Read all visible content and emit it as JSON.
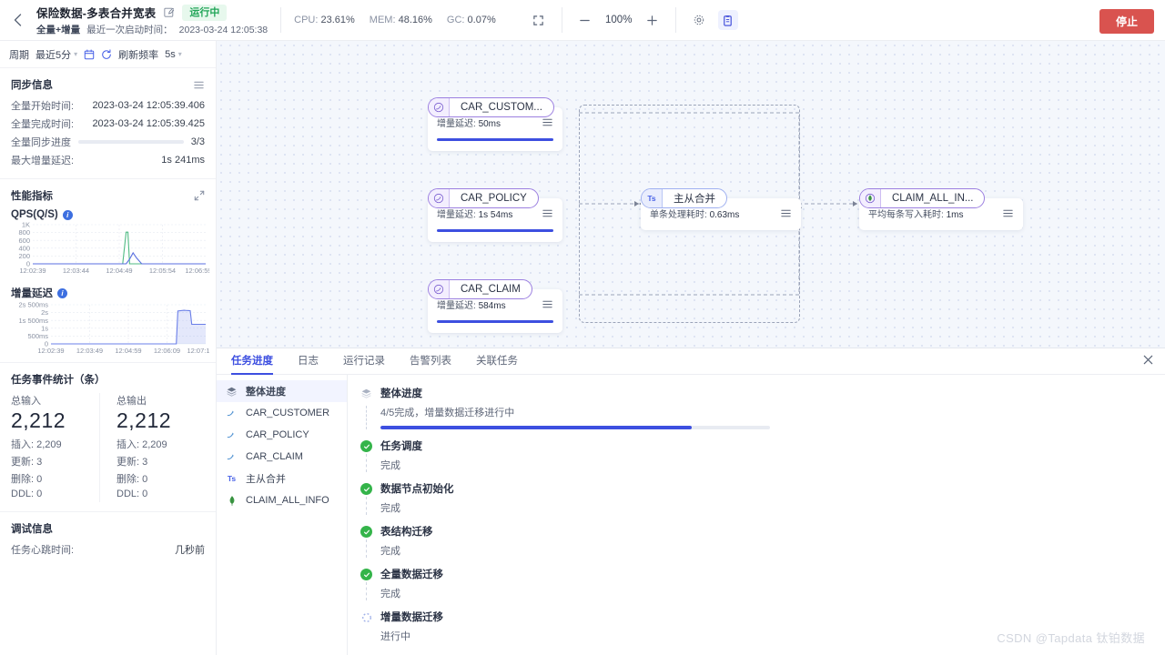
{
  "header": {
    "back_icon": "chevron-left-icon",
    "task_title": "保险数据-多表合并宽表",
    "edit_icon": "edit-icon",
    "status": "运行中",
    "sync_type": "全量+增量",
    "last_start_label": "最近一次启动时间：",
    "last_start_value": "2023-03-24 12:05:38",
    "cpu_label": "CPU:",
    "cpu_value": "23.61%",
    "mem_label": "MEM:",
    "mem_value": "48.16%",
    "gc_label": "GC:",
    "gc_value": "0.07%",
    "fit_icon": "fit-screen-icon",
    "zoom_out_icon": "minus-icon",
    "zoom_level": "100%",
    "zoom_in_icon": "plus-icon",
    "settings_icon": "gear-icon",
    "panel_icon": "clipboard-icon",
    "stop_button": "停止"
  },
  "period_bar": {
    "label": "周期",
    "range": "最近5分",
    "calendar_icon": "calendar-icon",
    "refresh_icon": "refresh-icon",
    "freq_label": "刷新频率",
    "freq_value": "5s"
  },
  "sync_info": {
    "title": "同步信息",
    "menu_icon": "list-icon",
    "rows": [
      {
        "key": "全量开始时间:",
        "value": "2023-03-24 12:05:39.406"
      },
      {
        "key": "全量完成时间:",
        "value": "2023-03-24 12:05:39.425"
      }
    ],
    "progress_label": "全量同步进度",
    "progress_value": "3/3",
    "progress_pct": 100,
    "max_delay_label": "最大增量延迟:",
    "max_delay_value": "1s 241ms"
  },
  "performance": {
    "title": "性能指标",
    "expand_icon": "expand-icon",
    "info_icon": "info-icon"
  },
  "chart_data": [
    {
      "type": "line",
      "title": "QPS(Q/S)",
      "xlabel": "",
      "ylabel": "",
      "ylim": [
        0,
        1000
      ],
      "yticks": [
        "0",
        "200",
        "400",
        "600",
        "800",
        "1K"
      ],
      "xticks": [
        "12:02:39",
        "12:03:44",
        "12:04:49",
        "12:05:54",
        "12:06:59"
      ],
      "grid": true,
      "legend": "none",
      "series": [
        {
          "name": "input",
          "color": "#4fbb83",
          "x": [
            0,
            52,
            54,
            55,
            56,
            58,
            100
          ],
          "values": [
            0,
            0,
            810,
            810,
            0,
            0,
            0
          ]
        },
        {
          "name": "output",
          "color": "#5a6fe0",
          "x": [
            0,
            54,
            56,
            58,
            60,
            63,
            100
          ],
          "values": [
            0,
            0,
            120,
            280,
            150,
            0,
            0
          ]
        }
      ]
    },
    {
      "type": "area",
      "title": "增量延迟",
      "xlabel": "",
      "ylabel": "",
      "ylim": [
        0,
        2500
      ],
      "yticks": [
        "0",
        "500ms",
        "1s",
        "1s 500ms",
        "2s",
        "2s 500ms"
      ],
      "xticks": [
        "12:02:39",
        "12:03:49",
        "12:04:59",
        "12:06:09",
        "12:07:1"
      ],
      "grid": true,
      "legend": "none",
      "series": [
        {
          "name": "delay",
          "color": "#6b7fe8",
          "x": [
            0,
            81,
            82,
            86,
            88,
            90,
            91,
            100
          ],
          "values": [
            0,
            0,
            2100,
            2150,
            2130,
            2120,
            1250,
            1250
          ]
        }
      ]
    }
  ],
  "events": {
    "title": "任务事件统计（条）",
    "columns": [
      {
        "label": "总输入",
        "total": "2,212",
        "rows": [
          {
            "key": "插入:",
            "value": "2,209"
          },
          {
            "key": "更新:",
            "value": "3"
          },
          {
            "key": "删除:",
            "value": "0"
          },
          {
            "key": "DDL:",
            "value": "0"
          }
        ]
      },
      {
        "label": "总输出",
        "total": "2,212",
        "rows": [
          {
            "key": "插入:",
            "value": "2,209"
          },
          {
            "key": "更新:",
            "value": "3"
          },
          {
            "key": "删除:",
            "value": "0"
          },
          {
            "key": "DDL:",
            "value": "0"
          }
        ]
      }
    ]
  },
  "debug": {
    "title": "调试信息",
    "heartbeat_label": "任务心跳时间:",
    "heartbeat_value": "几秒前"
  },
  "canvas": {
    "nodes": [
      {
        "id": "car_customer",
        "label": "CAR_CUSTOM...",
        "icon": "mysql-dolphin-icon",
        "metric_label": "增量延迟:",
        "metric_value": "50ms",
        "bar_pct": 100,
        "accent": "purple"
      },
      {
        "id": "car_policy",
        "label": "CAR_POLICY",
        "icon": "mysql-dolphin-icon",
        "metric_label": "增量延迟:",
        "metric_value": "1s 54ms",
        "bar_pct": 100,
        "accent": "purple"
      },
      {
        "id": "car_claim",
        "label": "CAR_CLAIM",
        "icon": "mysql-dolphin-icon",
        "metric_label": "增量延迟:",
        "metric_value": "584ms",
        "bar_pct": 100,
        "accent": "purple"
      },
      {
        "id": "merge",
        "label": "主从合并",
        "icon": "ts-icon",
        "metric_label": "单条处理耗时:",
        "metric_value": "0.63ms",
        "bar_pct": 0,
        "accent": "blue"
      },
      {
        "id": "claim_all_info",
        "label": "CLAIM_ALL_IN...",
        "icon": "mongodb-leaf-icon",
        "metric_label": "平均每条写入耗时:",
        "metric_value": "1ms",
        "bar_pct": 0,
        "accent": "purple"
      }
    ]
  },
  "bottom_panel": {
    "tabs": [
      {
        "label": "任务进度",
        "active": true
      },
      {
        "label": "日志",
        "active": false
      },
      {
        "label": "运行记录",
        "active": false
      },
      {
        "label": "告警列表",
        "active": false
      },
      {
        "label": "关联任务",
        "active": false
      }
    ],
    "close_icon": "close-icon",
    "node_list": [
      {
        "label": "整体进度",
        "icon": "layers-icon",
        "active": true
      },
      {
        "label": "CAR_CUSTOMER",
        "icon": "mysql-dolphin-icon",
        "active": false
      },
      {
        "label": "CAR_POLICY",
        "icon": "mysql-dolphin-icon",
        "active": false
      },
      {
        "label": "CAR_CLAIM",
        "icon": "mysql-dolphin-icon",
        "active": false
      },
      {
        "label": "主从合并",
        "icon": "ts-icon",
        "active": false
      },
      {
        "label": "CLAIM_ALL_INFO",
        "icon": "mongodb-leaf-icon",
        "active": false
      }
    ],
    "steps": [
      {
        "title": "整体进度",
        "sub": "4/5完成，增量数据迁移进行中",
        "mark": "layers-icon",
        "progress": 80
      },
      {
        "title": "任务调度",
        "sub": "完成",
        "mark": "check-icon"
      },
      {
        "title": "数据节点初始化",
        "sub": "完成",
        "mark": "check-icon"
      },
      {
        "title": "表结构迁移",
        "sub": "完成",
        "mark": "check-icon"
      },
      {
        "title": "全量数据迁移",
        "sub": "完成",
        "mark": "check-icon"
      },
      {
        "title": "增量数据迁移",
        "sub": "进行中",
        "mark": "spinner-icon"
      }
    ]
  },
  "watermark": "CSDN @Tapdata 钛铂数据",
  "colors": {
    "accent": "#3d4fe0",
    "success": "#34b44a",
    "danger": "#d9534f",
    "purple": "#9b7fe0"
  }
}
